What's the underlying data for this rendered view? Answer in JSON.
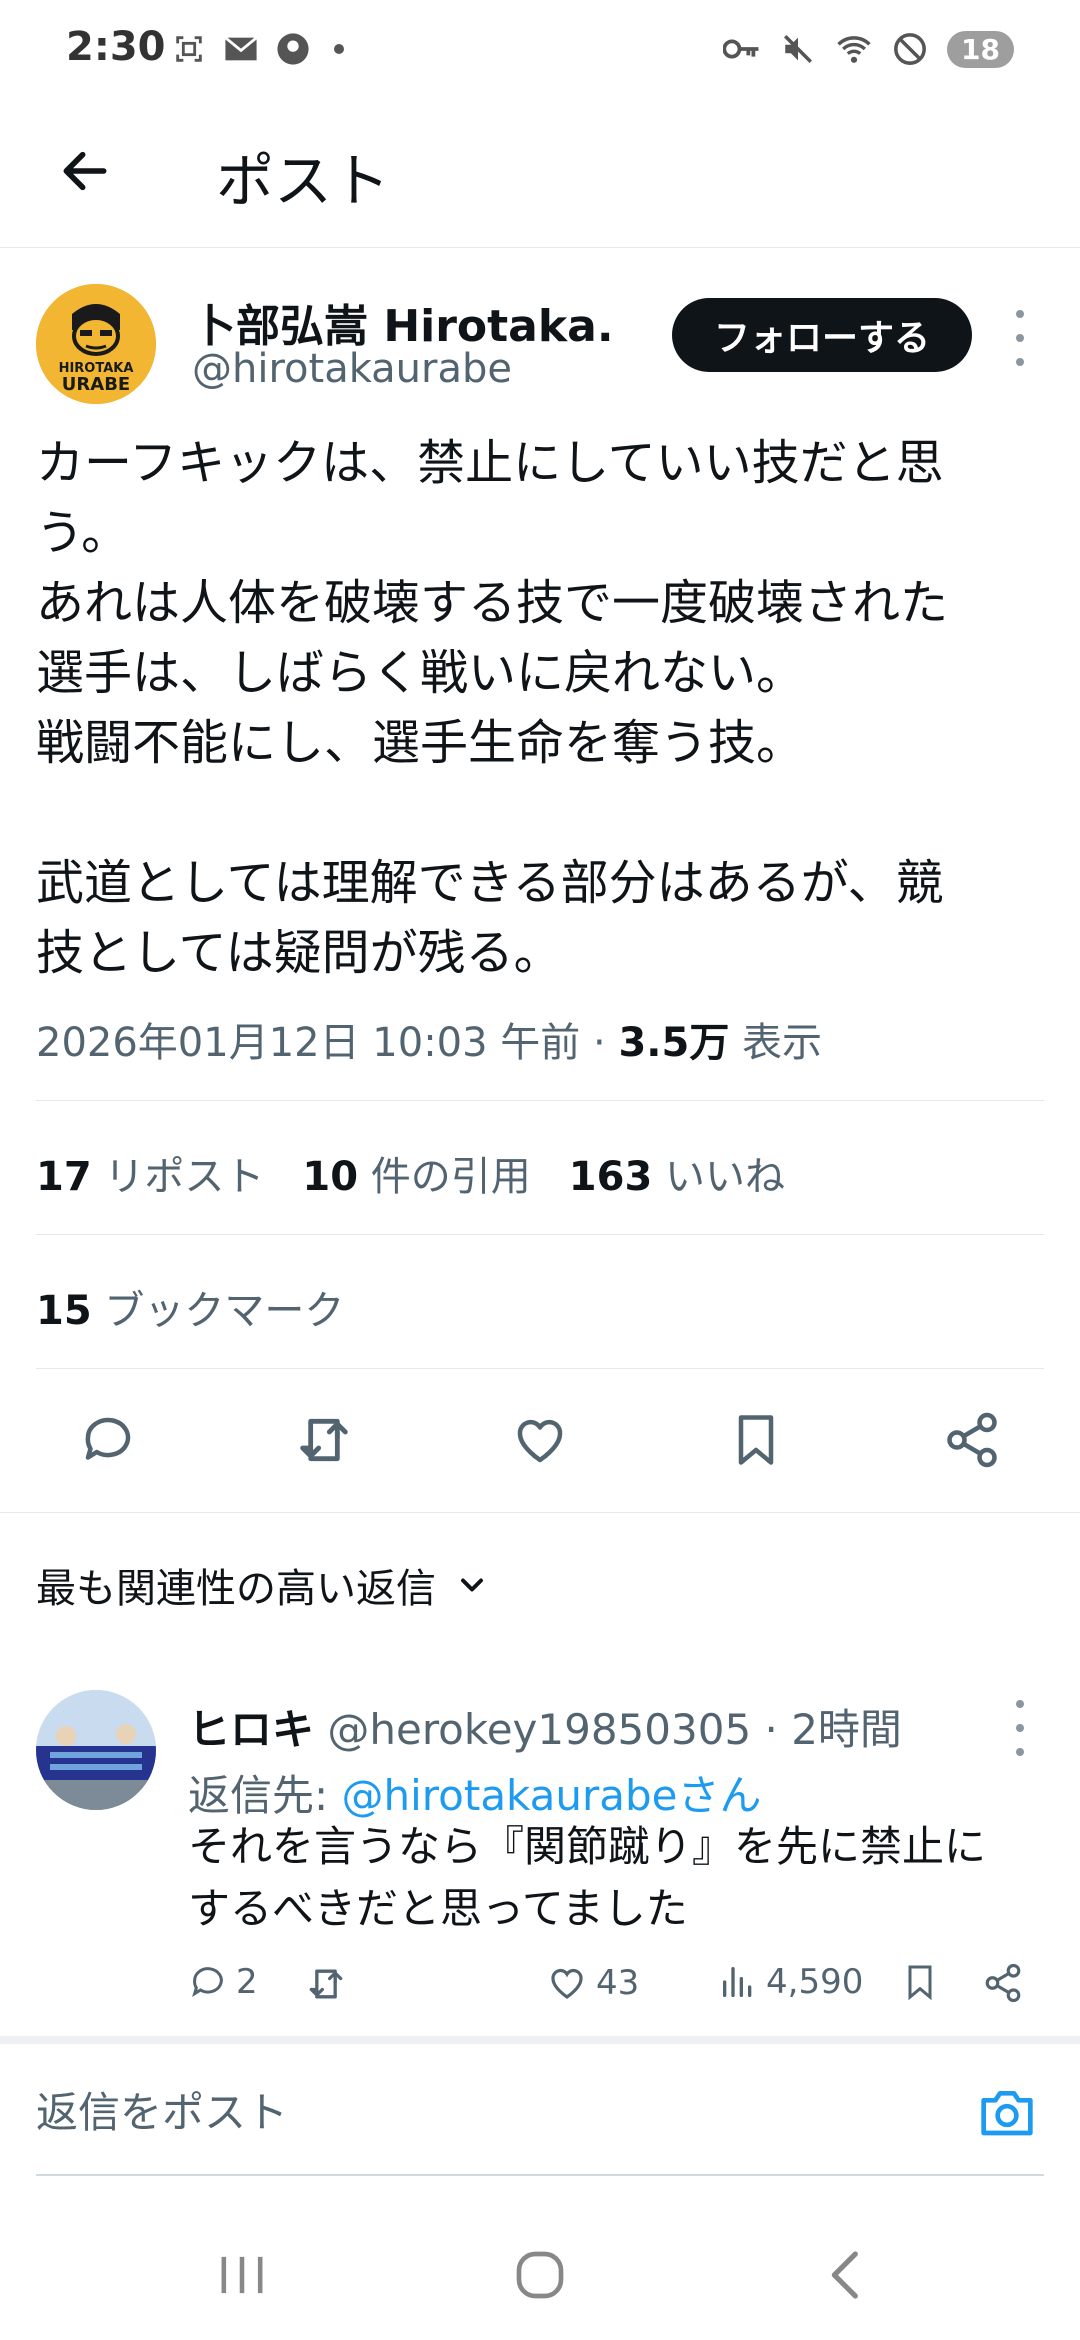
{
  "status_bar": {
    "time": "2:30",
    "battery": "18",
    "icons": [
      "screenshot-icon",
      "mail-icon",
      "account-icon",
      "key-icon",
      "mute-icon",
      "wifi-icon",
      "dnd-icon"
    ]
  },
  "app_bar": {
    "title": "ポスト"
  },
  "post": {
    "author_name": "卜部弘嵩 Hirotaka...",
    "author_handle": "@hirotakaurabe",
    "follow_label": "フォローする",
    "avatar_text_line1": "HIROTAKA",
    "avatar_text_line2": "URABE",
    "body_lines": [
      "カーフキックは、禁止にしていい技だと思",
      "う。",
      "あれは人体を破壊する技で一度破壊された",
      "選手は、しばらく戦いに戻れない。",
      "戦闘不能にし、選手生命を奪う技。",
      "",
      "武道としては理解できる部分はあるが、競",
      "技としては疑問が残る。"
    ],
    "timestamp": "2026年01月12日 10:03 午前 · ",
    "views_count": "3.5万",
    "views_label": " 表示",
    "reposts_count": "17",
    "reposts_label": " リポスト",
    "quotes_count": "10",
    "quotes_label": " 件の引用",
    "likes_count": "163",
    "likes_label": " いいね",
    "bookmarks_count": "15",
    "bookmarks_label": " ブックマーク"
  },
  "replies_section": {
    "sort_label": "最も関連性の高い返信"
  },
  "reply": {
    "name": "ヒロキ",
    "handle_time": " @herokey19850305 · 2時間",
    "reply_to_prefix": "返信先: ",
    "reply_to_handle": "@hirotakaurabeさん",
    "text_line1": "それを言うなら『関節蹴り』を先に禁止に",
    "text_line2": "するべきだと思ってました",
    "comments": "2",
    "likes": "43",
    "views": "4,590"
  },
  "compose": {
    "placeholder": "返信をポスト"
  },
  "colors": {
    "accent": "#1d9bf0",
    "text": "#0f1419",
    "secondary": "#536471"
  }
}
